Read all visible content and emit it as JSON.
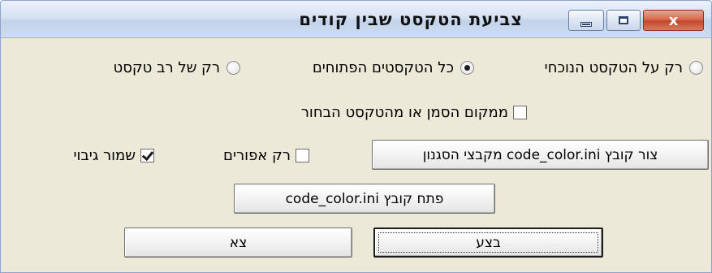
{
  "window": {
    "title": "צביעת הטקסט שבין קודים",
    "close_glyph": "x"
  },
  "scope_options": [
    {
      "label": "רק על הטקסט הנוכחי",
      "checked": false
    },
    {
      "label": "כל הטקסטים הפתוחים",
      "checked": true
    },
    {
      "label": "רק של רב טקסט",
      "checked": false
    }
  ],
  "options": {
    "from_cursor_label": "ממקום הסמן או מהטקסט הבחור",
    "from_cursor_checked": false,
    "only_sheets_label": "רק אפורים",
    "only_sheets_checked": false,
    "keep_backup_label": "שמור גיבוי",
    "keep_backup_checked": true
  },
  "buttons": {
    "create_ini": "צור קובץ code_color.ini מקבצי הסגנון",
    "open_ini": "פתח קובץ code_color.ini",
    "execute": "בצע",
    "exit": "צא"
  }
}
